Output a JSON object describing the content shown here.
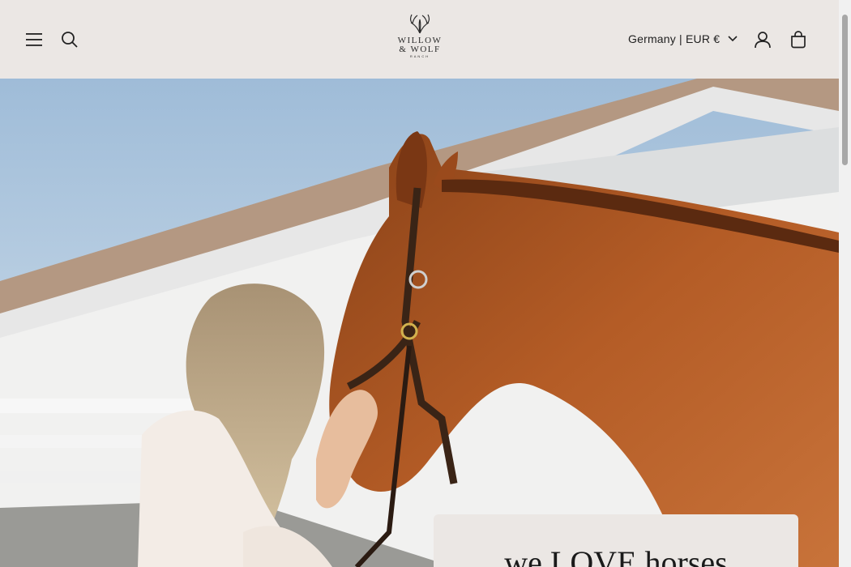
{
  "header": {
    "menu_icon": "hamburger-menu-icon",
    "search_icon": "search-icon",
    "account_icon": "user-icon",
    "cart_icon": "cart-icon",
    "logo": {
      "line1": "WILLOW",
      "line2": "& WOLF",
      "line3": "RANCH"
    },
    "locale_label": "Germany | EUR €"
  },
  "hero": {
    "image_alt": "Woman embracing a chestnut horse in front of a white stable",
    "heading": "we LOVE horses"
  },
  "colors": {
    "header_bg": "#ebe7e4",
    "text": "#1f1f1f",
    "card_bg": "#ebe7e4"
  }
}
